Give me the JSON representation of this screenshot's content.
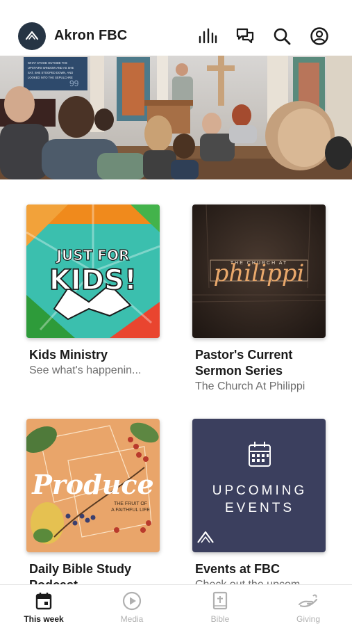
{
  "header": {
    "app_name": "Akron FBC",
    "icons": [
      "church-logo-icon",
      "media-bars-icon",
      "chat-icon",
      "search-icon",
      "profile-icon"
    ]
  },
  "hero": {
    "screen_lines": [
      "WHAT STOOD OUTSIDE THE",
      "UPSTAIRS WINDOW AND AS SHE",
      "SAT, SHE STOOPED DOWN, AND",
      "LOOKED INTO THE SEPULCHRE"
    ],
    "screen_number": "99"
  },
  "cards": [
    {
      "title": "Kids Ministry",
      "subtitle": "See what's happenin...",
      "art_text": [
        "JUST FOR",
        "KIDS!"
      ]
    },
    {
      "title": "Pastor's Current Sermon Series",
      "subtitle": "The Church At Philippi",
      "art_text": [
        "THE CHURCH AT",
        "philippi"
      ]
    },
    {
      "title": "Daily Bible Study Podcast",
      "subtitle": "",
      "art_text": [
        "Produce",
        "THE FRUIT OF",
        "A FAITHFUL LIFE"
      ]
    },
    {
      "title": "Events at FBC",
      "subtitle": "Check out the upcom...",
      "art_text": [
        "UPCOMING",
        "EVENTS"
      ]
    }
  ],
  "tabbar": {
    "tabs": [
      {
        "label": "This week",
        "icon": "calendar-icon",
        "active": true
      },
      {
        "label": "Media",
        "icon": "play-circle-icon",
        "active": false
      },
      {
        "label": "Bible",
        "icon": "bible-icon",
        "active": false
      },
      {
        "label": "Giving",
        "icon": "giving-hand-icon",
        "active": false
      }
    ]
  },
  "colors": {
    "logo_bg": "#263444",
    "events_bg": "#3b3f5e",
    "kids_teal": "#3bbfae",
    "produce_orange": "#e9a56a",
    "sermon_dark": "#2b211c",
    "active_tab": "#1a1a1a",
    "inactive_tab": "#b0b0b0"
  }
}
